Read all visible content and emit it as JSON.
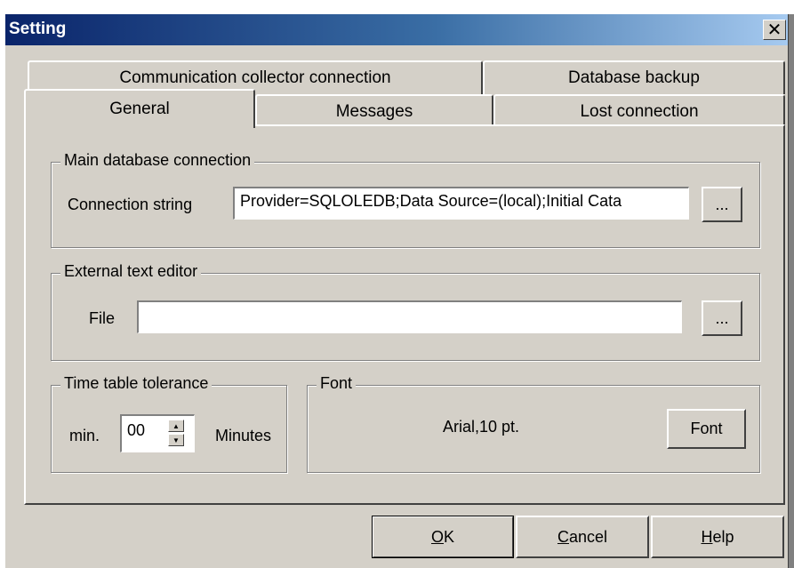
{
  "window": {
    "title": "Setting",
    "close_glyph": "✕"
  },
  "tabs": {
    "row_back": [
      {
        "label": "Communication collector connection"
      },
      {
        "label": "Database backup"
      }
    ],
    "row_front": [
      {
        "label": "General",
        "active": true
      },
      {
        "label": "Messages"
      },
      {
        "label": "Lost connection"
      }
    ]
  },
  "main_db": {
    "group_title": "Main database connection",
    "label": "Connection string",
    "value": "Provider=SQLOLEDB;Data Source=(local);Initial Cata",
    "browse_label": "..."
  },
  "editor": {
    "group_title": "External text editor",
    "label": "File",
    "value": "",
    "browse_label": "..."
  },
  "tolerance": {
    "group_title": "Time table tolerance",
    "prefix": "min.",
    "value": "00",
    "suffix": "Minutes"
  },
  "font": {
    "group_title": "Font",
    "current": "Arial,10 pt.",
    "button_label": "Font"
  },
  "buttons": {
    "ok_mnemonic": "O",
    "ok_rest": "K",
    "cancel_mnemonic": "C",
    "cancel_rest": "ancel",
    "help_mnemonic": "H",
    "help_rest": "elp"
  },
  "colors": {
    "face": "#d4d0c8",
    "title_start": "#0a246a",
    "title_end": "#a6caf0"
  }
}
